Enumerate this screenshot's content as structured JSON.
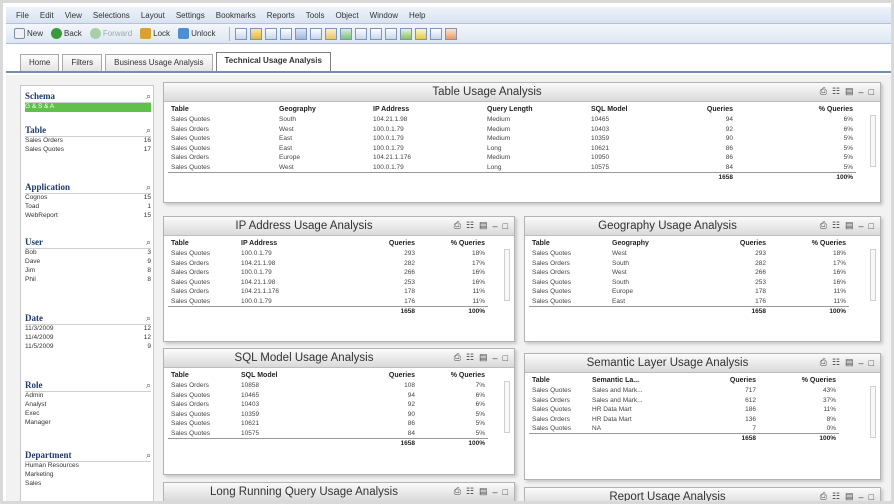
{
  "menu": [
    "File",
    "Edit",
    "View",
    "Selections",
    "Layout",
    "Settings",
    "Bookmarks",
    "Reports",
    "Tools",
    "Object",
    "Window",
    "Help"
  ],
  "toolbar": {
    "new": "New",
    "back": "Back",
    "forward": "Forward",
    "lock": "Lock",
    "unlock": "Unlock"
  },
  "tabs": [
    {
      "label": "Home",
      "active": false
    },
    {
      "label": "Filters",
      "active": false
    },
    {
      "label": "Business Usage Analysis",
      "active": false
    },
    {
      "label": "Technical Usage Analysis",
      "active": true
    }
  ],
  "sidebar": {
    "schema": {
      "title": "Schema",
      "items": [
        {
          "label": "G & S & A",
          "count": "",
          "selected": true
        }
      ]
    },
    "table": {
      "title": "Table",
      "items": [
        {
          "label": "Sales Orders",
          "count": "16"
        },
        {
          "label": "Sales Quotes",
          "count": "17"
        }
      ]
    },
    "application": {
      "title": "Application",
      "items": [
        {
          "label": "Cognos",
          "count": "15"
        },
        {
          "label": "Toad",
          "count": "1"
        },
        {
          "label": "WebReport",
          "count": "15"
        }
      ]
    },
    "user": {
      "title": "User",
      "items": [
        {
          "label": "Bob",
          "count": "3"
        },
        {
          "label": "Dave",
          "count": "9"
        },
        {
          "label": "Jim",
          "count": "8"
        },
        {
          "label": "Phil",
          "count": "8"
        }
      ]
    },
    "date": {
      "title": "Date",
      "items": [
        {
          "label": "11/3/2009",
          "count": "12"
        },
        {
          "label": "11/4/2009",
          "count": "12"
        },
        {
          "label": "11/5/2009",
          "count": "9"
        }
      ]
    },
    "role": {
      "title": "Role",
      "items": [
        {
          "label": "Admin",
          "count": ""
        },
        {
          "label": "Analyst",
          "count": ""
        },
        {
          "label": "Exec",
          "count": ""
        },
        {
          "label": "Manager",
          "count": ""
        }
      ]
    },
    "department": {
      "title": "Department",
      "items": [
        {
          "label": "Human Resources",
          "count": ""
        },
        {
          "label": "Marketing",
          "count": ""
        },
        {
          "label": "Sales",
          "count": ""
        }
      ]
    }
  },
  "panels": {
    "table_usage": {
      "title": "Table Usage Analysis",
      "headers": [
        "Table",
        "Geography",
        "IP Address",
        "Query Length",
        "SQL Model",
        "Queries",
        "% Queries"
      ],
      "rows": [
        [
          "Sales Quotes",
          "South",
          "104.21.1.98",
          "Medium",
          "10465",
          "94",
          "6%"
        ],
        [
          "Sales Orders",
          "West",
          "100.0.1.79",
          "Medium",
          "10403",
          "92",
          "6%"
        ],
        [
          "Sales Quotes",
          "East",
          "100.0.1.79",
          "Medium",
          "10359",
          "90",
          "5%"
        ],
        [
          "Sales Quotes",
          "East",
          "100.0.1.79",
          "Long",
          "10621",
          "86",
          "5%"
        ],
        [
          "Sales Orders",
          "Europe",
          "104.21.1.176",
          "Medium",
          "10950",
          "86",
          "5%"
        ],
        [
          "Sales Quotes",
          "West",
          "100.0.1.79",
          "Long",
          "10575",
          "84",
          "5%"
        ]
      ],
      "total_queries": "1658",
      "total_pct": "100%"
    },
    "ip_usage": {
      "title": "IP Address Usage Analysis",
      "headers": [
        "Table",
        "IP Address",
        "Queries",
        "% Queries"
      ],
      "rows": [
        [
          "Sales Quotes",
          "100.0.1.79",
          "293",
          "18%"
        ],
        [
          "Sales Orders",
          "104.21.1.98",
          "282",
          "17%"
        ],
        [
          "Sales Orders",
          "100.0.1.79",
          "266",
          "16%"
        ],
        [
          "Sales Quotes",
          "104.21.1.98",
          "253",
          "16%"
        ],
        [
          "Sales Orders",
          "104.21.1.176",
          "178",
          "11%"
        ],
        [
          "Sales Quotes",
          "100.0.1.79",
          "176",
          "11%"
        ]
      ],
      "total_queries": "1658",
      "total_pct": "100%"
    },
    "geo_usage": {
      "title": "Geography Usage Analysis",
      "headers": [
        "Table",
        "Geography",
        "Queries",
        "% Queries"
      ],
      "rows": [
        [
          "Sales Quotes",
          "West",
          "293",
          "18%"
        ],
        [
          "Sales Orders",
          "South",
          "282",
          "17%"
        ],
        [
          "Sales Orders",
          "West",
          "266",
          "16%"
        ],
        [
          "Sales Quotes",
          "South",
          "253",
          "16%"
        ],
        [
          "Sales Quotes",
          "Europe",
          "178",
          "11%"
        ],
        [
          "Sales Quotes",
          "East",
          "176",
          "11%"
        ]
      ],
      "total_queries": "1658",
      "total_pct": "100%"
    },
    "sql_usage": {
      "title": "SQL Model Usage Analysis",
      "headers": [
        "Table",
        "SQL Model",
        "Queries",
        "% Queries"
      ],
      "rows": [
        [
          "Sales Orders",
          "10858",
          "108",
          "7%"
        ],
        [
          "Sales Quotes",
          "10465",
          "94",
          "6%"
        ],
        [
          "Sales Orders",
          "10403",
          "92",
          "6%"
        ],
        [
          "Sales Quotes",
          "10359",
          "90",
          "5%"
        ],
        [
          "Sales Quotes",
          "10621",
          "86",
          "5%"
        ],
        [
          "Sales Quotes",
          "10575",
          "84",
          "5%"
        ]
      ],
      "total_queries": "1658",
      "total_pct": "100%"
    },
    "semantic_usage": {
      "title": "Semantic Layer Usage Analysis",
      "headers": [
        "Table",
        "Semantic La...",
        "Queries",
        "% Queries"
      ],
      "rows": [
        [
          "Sales Quotes",
          "Sales and Mark...",
          "717",
          "43%"
        ],
        [
          "Sales Orders",
          "Sales and Mark...",
          "612",
          "37%"
        ],
        [
          "Sales Quotes",
          "HR Data Mart",
          "186",
          "11%"
        ],
        [
          "Sales Orders",
          "HR Data Mart",
          "136",
          "8%"
        ],
        [
          "Sales Quotes",
          "NA",
          "7",
          "0%"
        ]
      ],
      "total_queries": "1658",
      "total_pct": "100%"
    },
    "long_running": {
      "title": "Long Running Query Usage Analysis"
    },
    "report_usage": {
      "title": "Report Usage Analysis"
    }
  }
}
